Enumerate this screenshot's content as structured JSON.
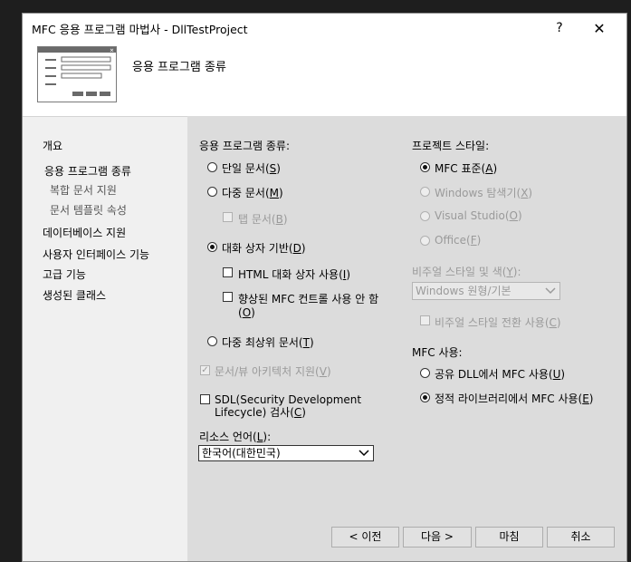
{
  "window": {
    "title": "MFC 응용 프로그램 마법사 - DllTestProject",
    "help": "?",
    "close": "✕"
  },
  "header": {
    "title": "응용 프로그램 종류"
  },
  "nav": {
    "overview": "개요",
    "app_type": "응용 프로그램 종류",
    "compound": "복합 문서 지원",
    "template": "문서 템플릿 속성",
    "database": "데이터베이스 지원",
    "ui": "사용자 인터페이스 기능",
    "advanced": "고급 기능",
    "generated": "생성된 클래스"
  },
  "app_type": {
    "label": "응용 프로그램 종류:",
    "single": {
      "text": "단일 문서(",
      "key": "S",
      "end": ")"
    },
    "multiple": {
      "text": "다중 문서(",
      "key": "M",
      "end": ")"
    },
    "tabbed": {
      "text": "탭 문서(",
      "key": "B",
      "end": ")"
    },
    "dialog": {
      "text": "대화 상자 기반(",
      "key": "D",
      "end": ")"
    },
    "html_dialog": {
      "text": "HTML 대화 상자 사용(",
      "key": "I",
      "end": ")"
    },
    "enhanced_line1": "향상된 MFC 컨트롤 사용 안 함",
    "enhanced_line2": {
      "text": "(",
      "key": "O",
      "end": ")"
    },
    "multi_top": {
      "text": "다중 최상위 문서(",
      "key": "T",
      "end": ")"
    },
    "docview": {
      "text": "문서/뷰 아키텍처 지원(",
      "key": "V",
      "end": ")"
    },
    "sdl_line1": "SDL(Security Development",
    "sdl_line2": {
      "text": "Lifecycle) 검사(",
      "key": "C",
      "end": ")"
    }
  },
  "resource": {
    "label": {
      "text": "리소스 언어(",
      "key": "L",
      "end": "):"
    },
    "value": "한국어(대한민국)"
  },
  "project_style": {
    "label": "프로젝트 스타일:",
    "mfc_std": {
      "text": "MFC 표준(",
      "key": "A",
      "end": ")"
    },
    "explorer": {
      "text": "Windows 탐색기(",
      "key": "X",
      "end": ")"
    },
    "vstudio": {
      "text": "Visual Studio(",
      "key": "O",
      "end": ")"
    },
    "office": {
      "text": "Office(",
      "key": "F",
      "end": ")"
    }
  },
  "visual": {
    "label": {
      "text": "비주얼 스타일 및 색(",
      "key": "Y",
      "end": "):"
    },
    "value": "Windows 원형/기본",
    "switch": {
      "text": "비주얼 스타일 전환 사용(",
      "key": "C",
      "end": ")"
    }
  },
  "mfc_use": {
    "label": "MFC 사용:",
    "shared": {
      "text": "공유 DLL에서 MFC 사용(",
      "key": "U",
      "end": ")"
    },
    "static": {
      "text": "정적 라이브러리에서 MFC 사용(",
      "key": "E",
      "end": ")"
    }
  },
  "buttons": {
    "prev": "< 이전",
    "next": "다음 >",
    "finish": "마침",
    "cancel": "취소"
  }
}
